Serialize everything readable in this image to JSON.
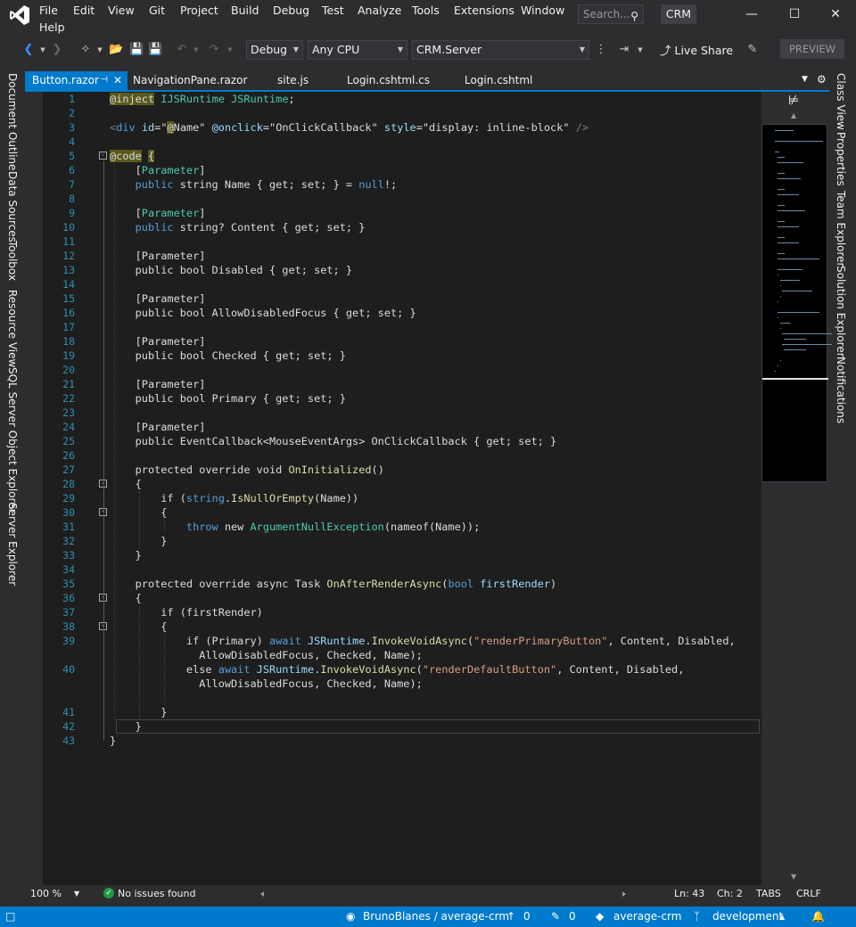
{
  "menu": {
    "items": [
      "File",
      "Edit",
      "View",
      "Git",
      "Project",
      "Build",
      "Debug",
      "Test",
      "Analyze",
      "Tools",
      "Extensions",
      "Window",
      "Help"
    ]
  },
  "search": {
    "placeholder": "Search..."
  },
  "solution_name": "CRM",
  "toolbar": {
    "configuration": "Debug",
    "platform": "Any CPU",
    "startup_project": "CRM.Server",
    "live_share": "Live Share",
    "preview": "PREVIEW"
  },
  "left_tabs": [
    "Document Outline",
    "Data Sources",
    "Toolbox",
    "Resource View",
    "SQL Server Object Explorer",
    "Server Explorer"
  ],
  "right_tabs": [
    "Class View",
    "Properties",
    "Team Explorer",
    "Solution Explorer",
    "Notifications"
  ],
  "doc_tabs": [
    {
      "label": "Button.razor",
      "active": true
    },
    {
      "label": "NavigationPane.razor",
      "active": false
    },
    {
      "label": "site.js",
      "active": false
    },
    {
      "label": "Login.cshtml.cs",
      "active": false
    },
    {
      "label": "Login.cshtml",
      "active": false
    }
  ],
  "code": {
    "line_numbers": [
      "1",
      "2",
      "3",
      "4",
      "5",
      "6",
      "7",
      "8",
      "9",
      "10",
      "11",
      "12",
      "13",
      "14",
      "15",
      "16",
      "17",
      "18",
      "19",
      "20",
      "21",
      "22",
      "23",
      "24",
      "25",
      "26",
      "27",
      "28",
      "29",
      "30",
      "31",
      "32",
      "33",
      "34",
      "35",
      "36",
      "37",
      "38",
      "39",
      "40",
      "41",
      "42",
      "43"
    ],
    "lines": [
      {
        "n": 1,
        "tokens": [
          [
            "dir",
            "@inject"
          ],
          [
            "plain",
            " "
          ],
          [
            "type",
            "IJSRuntime"
          ],
          [
            "plain",
            " "
          ],
          [
            "type",
            "JSRuntime"
          ],
          [
            "plain",
            ";"
          ]
        ]
      },
      {
        "n": 2,
        "tokens": []
      },
      {
        "n": 3,
        "tokens": [
          [
            "tag",
            "<"
          ],
          [
            "kw",
            "div"
          ],
          [
            "plain",
            " "
          ],
          [
            "attrname",
            "id"
          ],
          [
            "plain",
            "=\""
          ],
          [
            "dir",
            "@"
          ],
          [
            "plain",
            "Name\" "
          ],
          [
            "attrname",
            "@onclick"
          ],
          [
            "plain",
            "=\"OnClickCallback\" "
          ],
          [
            "attrname",
            "style"
          ],
          [
            "plain",
            "=\"display: inline-block\" "
          ],
          [
            "tag",
            "/>"
          ]
        ]
      },
      {
        "n": 4,
        "tokens": []
      },
      {
        "n": 5,
        "tokens": [
          [
            "dir",
            "@code"
          ],
          [
            "plain",
            " "
          ],
          [
            "hl",
            "{"
          ]
        ]
      },
      {
        "n": 6,
        "tokens": [
          [
            "plain",
            "    ["
          ],
          [
            "type",
            "Parameter"
          ],
          [
            "plain",
            "]"
          ]
        ]
      },
      {
        "n": 7,
        "tokens": [
          [
            "plain",
            "    "
          ],
          [
            "kw",
            "public"
          ],
          [
            "plain",
            " string Name { get; set; } = "
          ],
          [
            "kw",
            "null"
          ],
          [
            "plain",
            "!;"
          ]
        ]
      },
      {
        "n": 8,
        "tokens": []
      },
      {
        "n": 9,
        "tokens": [
          [
            "plain",
            "    ["
          ],
          [
            "type",
            "Parameter"
          ],
          [
            "plain",
            "]"
          ]
        ]
      },
      {
        "n": 10,
        "tokens": [
          [
            "plain",
            "    "
          ],
          [
            "kw",
            "public"
          ],
          [
            "plain",
            " string? Content { get; set; }"
          ]
        ]
      },
      {
        "n": 11,
        "tokens": []
      },
      {
        "n": 12,
        "tokens": [
          [
            "plain",
            "    [Parameter]"
          ]
        ]
      },
      {
        "n": 13,
        "tokens": [
          [
            "plain",
            "    public bool Disabled { get; set; }"
          ]
        ]
      },
      {
        "n": 14,
        "tokens": []
      },
      {
        "n": 15,
        "tokens": [
          [
            "plain",
            "    [Parameter]"
          ]
        ]
      },
      {
        "n": 16,
        "tokens": [
          [
            "plain",
            "    public bool AllowDisabledFocus { get; set; }"
          ]
        ]
      },
      {
        "n": 17,
        "tokens": []
      },
      {
        "n": 18,
        "tokens": [
          [
            "plain",
            "    [Parameter]"
          ]
        ]
      },
      {
        "n": 19,
        "tokens": [
          [
            "plain",
            "    public bool Checked { get; set; }"
          ]
        ]
      },
      {
        "n": 20,
        "tokens": []
      },
      {
        "n": 21,
        "tokens": [
          [
            "plain",
            "    [Parameter]"
          ]
        ]
      },
      {
        "n": 22,
        "tokens": [
          [
            "plain",
            "    public bool Primary { get; set; }"
          ]
        ]
      },
      {
        "n": 23,
        "tokens": []
      },
      {
        "n": 24,
        "tokens": [
          [
            "plain",
            "    [Parameter]"
          ]
        ]
      },
      {
        "n": 25,
        "tokens": [
          [
            "plain",
            "    public EventCallback<MouseEventArgs> OnClickCallback { get; set; }"
          ]
        ]
      },
      {
        "n": 26,
        "tokens": []
      },
      {
        "n": 27,
        "tokens": [
          [
            "plain",
            "    protected override void "
          ],
          [
            "method",
            "OnInitialized"
          ],
          [
            "plain",
            "()"
          ]
        ]
      },
      {
        "n": 28,
        "tokens": [
          [
            "plain",
            "    {"
          ]
        ]
      },
      {
        "n": 29,
        "tokens": [
          [
            "plain",
            "        if ("
          ],
          [
            "kw",
            "string"
          ],
          [
            "plain",
            "."
          ],
          [
            "method",
            "IsNullOrEmpty"
          ],
          [
            "plain",
            "(Name))"
          ]
        ]
      },
      {
        "n": 30,
        "tokens": [
          [
            "plain",
            "        {"
          ]
        ]
      },
      {
        "n": 31,
        "tokens": [
          [
            "plain",
            "            "
          ],
          [
            "kw",
            "throw"
          ],
          [
            "plain",
            " new "
          ],
          [
            "type",
            "ArgumentNullException"
          ],
          [
            "plain",
            "(nameof(Name));"
          ]
        ]
      },
      {
        "n": 32,
        "tokens": [
          [
            "plain",
            "        }"
          ]
        ]
      },
      {
        "n": 33,
        "tokens": [
          [
            "plain",
            "    }"
          ]
        ]
      },
      {
        "n": 34,
        "tokens": []
      },
      {
        "n": 35,
        "tokens": [
          [
            "plain",
            "    protected override async Task "
          ],
          [
            "method",
            "OnAfterRenderAsync"
          ],
          [
            "plain",
            "("
          ],
          [
            "kw",
            "bool"
          ],
          [
            "plain",
            " "
          ],
          [
            "param",
            "firstRender"
          ],
          [
            "plain",
            ")"
          ]
        ]
      },
      {
        "n": 36,
        "tokens": [
          [
            "plain",
            "    {"
          ]
        ]
      },
      {
        "n": 37,
        "tokens": [
          [
            "plain",
            "        if (firstRender)"
          ]
        ]
      },
      {
        "n": 38,
        "tokens": [
          [
            "plain",
            "        {"
          ]
        ]
      },
      {
        "n": 39,
        "tokens": [
          [
            "plain",
            "            if (Primary) "
          ],
          [
            "kw",
            "await"
          ],
          [
            "plain",
            " "
          ],
          [
            "param",
            "JSRuntime"
          ],
          [
            "plain",
            "."
          ],
          [
            "method",
            "InvokeVoidAsync"
          ],
          [
            "plain",
            "("
          ],
          [
            "str",
            "\"renderPrimaryButton\""
          ],
          [
            "plain",
            ", Content, Disabled,"
          ]
        ]
      },
      {
        "n": 0,
        "tokens": [
          [
            "plain",
            "              AllowDisabledFocus, Checked, Name);"
          ]
        ]
      },
      {
        "n": 40,
        "tokens": [
          [
            "plain",
            "            else "
          ],
          [
            "kw",
            "await"
          ],
          [
            "plain",
            " "
          ],
          [
            "param",
            "JSRuntime"
          ],
          [
            "plain",
            "."
          ],
          [
            "method",
            "InvokeVoidAsync"
          ],
          [
            "plain",
            "("
          ],
          [
            "str",
            "\"renderDefaultButton\""
          ],
          [
            "plain",
            ", Content, Disabled,"
          ]
        ]
      },
      {
        "n": 0,
        "tokens": [
          [
            "plain",
            "              AllowDisabledFocus, Checked, Name);"
          ]
        ]
      },
      {
        "n": 0,
        "tokens": []
      },
      {
        "n": 41,
        "tokens": [
          [
            "plain",
            "        }"
          ]
        ]
      },
      {
        "n": 42,
        "tokens": [
          [
            "plain",
            "    }"
          ]
        ]
      },
      {
        "n": 43,
        "tokens": [
          [
            "plain",
            "}"
          ]
        ]
      }
    ]
  },
  "editor_status": {
    "zoom": "100 %",
    "issues": "No issues found",
    "line": "Ln: 43",
    "char": "Ch: 2",
    "indent": "TABS",
    "line_ending": "CRLF"
  },
  "statusbar": {
    "repo": "BrunoBlanes / average-crm",
    "push_count": "0",
    "changes_count": "0",
    "repo_name": "average-crm",
    "branch": "development"
  },
  "colors": {
    "accent": "#007acc",
    "keyword": "#569cd6",
    "type": "#4ec9b0",
    "string": "#d69d85",
    "method": "#dcdcaa"
  }
}
